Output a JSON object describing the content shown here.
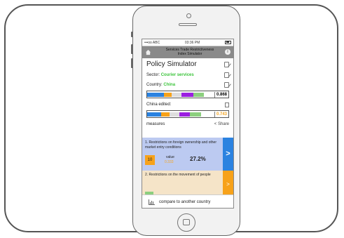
{
  "status_bar": {
    "carrier": "•••oo ABC",
    "time": "03:36 PM"
  },
  "header": {
    "title_line1": "Services Trade Restrictiveness",
    "title_line2": "Index Simulator"
  },
  "simulator": {
    "title": "Policy Simulator",
    "sector_label": "Sector:",
    "sector_value": "Courier services",
    "country_label": "Country:",
    "country_value": "China",
    "score": "0.868",
    "edited_label": "China edited:",
    "edited_score": "0.743"
  },
  "measures": {
    "label": "measures",
    "share_label": "Share",
    "items": [
      {
        "text": "1. Restrictions on foreign ownership and other market entry conditions",
        "number": "10",
        "value_label": "value",
        "value": "0.333",
        "percent": "27.2%"
      },
      {
        "text": "2. Restrictions on the movement of people"
      }
    ]
  },
  "footer": {
    "compare_label": "compare to another country"
  },
  "colors": {
    "accent_blue": "#2b82e0",
    "accent_orange": "#f7a21a",
    "sector_green": "#3cc43c",
    "purple": "#9b1fe0",
    "seg_green": "#8ccf7e"
  }
}
